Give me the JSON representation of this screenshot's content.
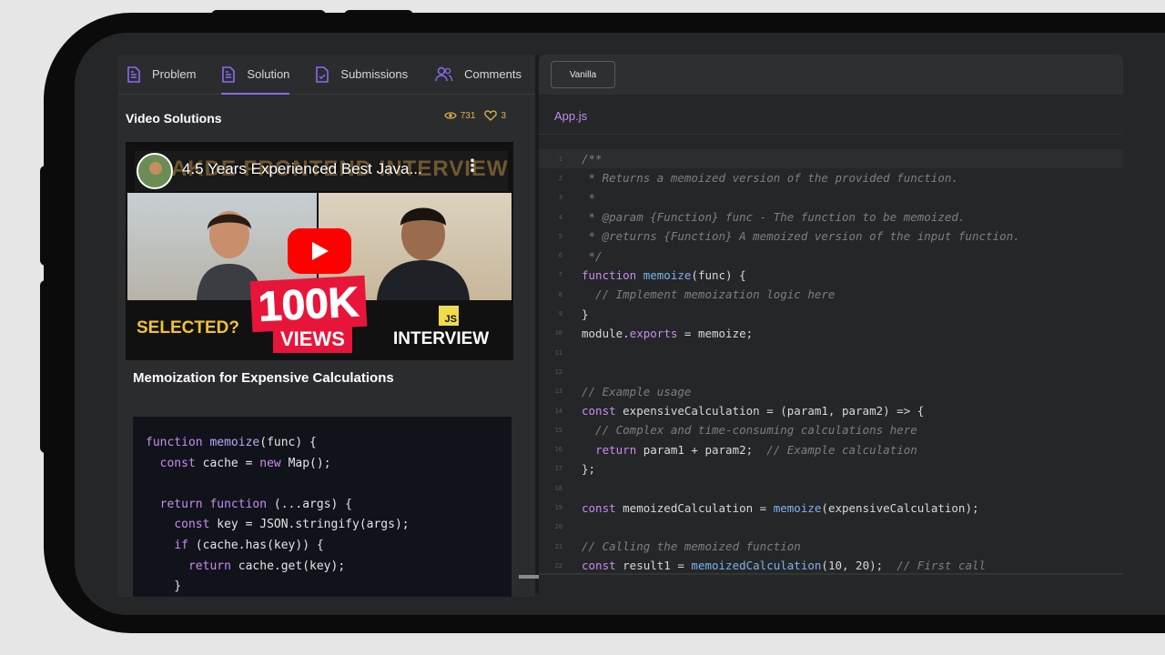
{
  "tabs": [
    {
      "label": "Problem",
      "icon": "document-icon"
    },
    {
      "label": "Solution",
      "icon": "document-icon",
      "active": true
    },
    {
      "label": "Submissions",
      "icon": "submission-icon"
    },
    {
      "label": "Comments",
      "icon": "users-icon"
    }
  ],
  "video_section": {
    "title": "Video Solutions",
    "views": "731",
    "likes": "3"
  },
  "video": {
    "title": "4.5 Years Experienced Best Java...",
    "thumbnail_bg_text": "AKDE FRONTEND INTERVIEW",
    "badge_count": "100K",
    "badge_views": "VIEWS",
    "selected_text": "SELECTED?",
    "js_badge": "JS",
    "interview_text": "INTERVIEW"
  },
  "memo_title": "Memoization for Expensive Calculations",
  "left_code": [
    [
      {
        "t": "function ",
        "c": "kw"
      },
      {
        "t": "memoize",
        "c": "fn"
      },
      {
        "t": "(func) {",
        "c": ""
      }
    ],
    [
      {
        "t": "  ",
        "c": ""
      },
      {
        "t": "const ",
        "c": "kw"
      },
      {
        "t": "cache = ",
        "c": ""
      },
      {
        "t": "new ",
        "c": "kw"
      },
      {
        "t": "Map();",
        "c": ""
      }
    ],
    [
      {
        "t": "",
        "c": ""
      }
    ],
    [
      {
        "t": "  ",
        "c": ""
      },
      {
        "t": "return ",
        "c": "kw"
      },
      {
        "t": "function ",
        "c": "kw"
      },
      {
        "t": "(...args) {",
        "c": ""
      }
    ],
    [
      {
        "t": "    ",
        "c": ""
      },
      {
        "t": "const ",
        "c": "kw"
      },
      {
        "t": "key = JSON.stringify(args);",
        "c": ""
      }
    ],
    [
      {
        "t": "    ",
        "c": ""
      },
      {
        "t": "if ",
        "c": "kw"
      },
      {
        "t": "(cache.has(key)) {",
        "c": ""
      }
    ],
    [
      {
        "t": "      ",
        "c": ""
      },
      {
        "t": "return ",
        "c": "kw"
      },
      {
        "t": "cache.get(key);",
        "c": ""
      }
    ],
    [
      {
        "t": "    }",
        "c": ""
      }
    ]
  ],
  "editor": {
    "framework_button": "Vanilla",
    "file_tab": "App.js",
    "lines": [
      [
        {
          "t": "/**",
          "c": "cm"
        }
      ],
      [
        {
          "t": " * Returns a memoized version of the provided function.",
          "c": "cm"
        }
      ],
      [
        {
          "t": " *",
          "c": "cm"
        }
      ],
      [
        {
          "t": " * @param {Function} func - The function to be memoized.",
          "c": "cm"
        }
      ],
      [
        {
          "t": " * @returns {Function} A memoized version of the input function.",
          "c": "cm"
        }
      ],
      [
        {
          "t": " */",
          "c": "cm"
        }
      ],
      [
        {
          "t": "function ",
          "c": "kwp"
        },
        {
          "t": "memoize",
          "c": "fnb"
        },
        {
          "t": "(func) {",
          "c": "nm"
        }
      ],
      [
        {
          "t": "  // Implement memoization logic here",
          "c": "cm"
        }
      ],
      [
        {
          "t": "}",
          "c": "nm"
        }
      ],
      [
        {
          "t": "module.",
          "c": "nm"
        },
        {
          "t": "exports",
          "c": "kwp"
        },
        {
          "t": " = memoize;",
          "c": "nm"
        }
      ],
      [
        {
          "t": "",
          "c": "nm"
        }
      ],
      [
        {
          "t": "",
          "c": "nm"
        }
      ],
      [
        {
          "t": "// Example usage",
          "c": "cm"
        }
      ],
      [
        {
          "t": "const ",
          "c": "kwp"
        },
        {
          "t": "expensiveCalculation = (param1, param2) => {",
          "c": "nm"
        }
      ],
      [
        {
          "t": "  // Complex and time-consuming calculations here",
          "c": "cm"
        }
      ],
      [
        {
          "t": "  ",
          "c": "nm"
        },
        {
          "t": "return ",
          "c": "kwp"
        },
        {
          "t": "param1 + param2;  ",
          "c": "nm"
        },
        {
          "t": "// Example calculation",
          "c": "cm"
        }
      ],
      [
        {
          "t": "};",
          "c": "nm"
        }
      ],
      [
        {
          "t": "",
          "c": "nm"
        }
      ],
      [
        {
          "t": "const ",
          "c": "kwp"
        },
        {
          "t": "memoizedCalculation = ",
          "c": "nm"
        },
        {
          "t": "memoize",
          "c": "fnb"
        },
        {
          "t": "(expensiveCalculation);",
          "c": "nm"
        }
      ],
      [
        {
          "t": "",
          "c": "nm"
        }
      ],
      [
        {
          "t": "// Calling the memoized function",
          "c": "cm"
        }
      ],
      [
        {
          "t": "const ",
          "c": "kwp"
        },
        {
          "t": "result1 = ",
          "c": "nm"
        },
        {
          "t": "memoizedCalculation",
          "c": "fnb"
        },
        {
          "t": "(10, 20);  ",
          "c": "nm"
        },
        {
          "t": "// First call",
          "c": "cm"
        }
      ]
    ]
  },
  "colors": {
    "accent": "#8b6cf0",
    "stats": "#e0b54a",
    "file_tab": "#c18ef2",
    "keyword": "#c98bf2",
    "function_name": "#7ab3ee",
    "comment": "#7b7f86"
  }
}
